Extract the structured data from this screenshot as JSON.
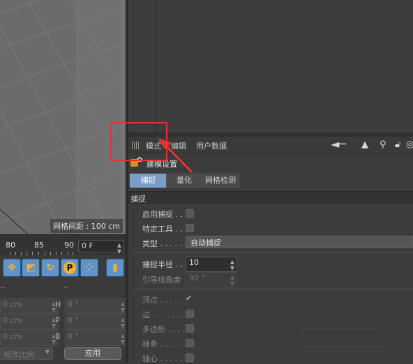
{
  "viewport": {
    "grid_spacing_label": "网格间距 : 100 cm"
  },
  "timeline": {
    "ticks": [
      "80",
      "85",
      "90"
    ],
    "frame_value": "0 F"
  },
  "toolbar_icons": [
    "move-icon",
    "scale-icon",
    "rotate-icon",
    "p-icon",
    "dots-icon",
    "film-icon"
  ],
  "coordinates": {
    "headers": [
      "--",
      "--"
    ],
    "rows": [
      {
        "left_value": "0 cm",
        "label": "H",
        "right_value": "0 °"
      },
      {
        "left_value": "0 cm",
        "label": "P",
        "right_value": "0 °"
      },
      {
        "left_value": "0 cm",
        "label": "B",
        "right_value": "0 °"
      }
    ],
    "scale_dropdown": "缩放比例",
    "apply_label": "应用"
  },
  "attribute_manager": {
    "menu": [
      "模式",
      "编辑",
      "用户数据"
    ],
    "title": "建模设置",
    "tabs": [
      {
        "label": "捕捉",
        "active": true
      },
      {
        "label": "量化",
        "active": false
      },
      {
        "label": "网格检测",
        "active": false
      }
    ],
    "section": "捕捉",
    "params": {
      "enable_snap": "启用捕捉 . .",
      "specific_tool": "特定工具 . .",
      "type_label": "类型 . . . . . .",
      "type_value": "自动捕捉",
      "snap_radius_label": "捕捉半径 . .",
      "snap_radius_value": "10",
      "guide_angle_label": "引导线角度",
      "guide_angle_value": "90 °",
      "vertex": "顶点 . . . . .",
      "edge": "边 . . . . . . . .",
      "polygon": "多边形 . . . .",
      "spline": "样条 . . . . .",
      "axis": "轴心 . . . . ."
    }
  },
  "colors": {
    "accent_tab": "#7a9cc6",
    "tool_blue": "#5f93c9",
    "annotation_red": "#e8322f"
  }
}
